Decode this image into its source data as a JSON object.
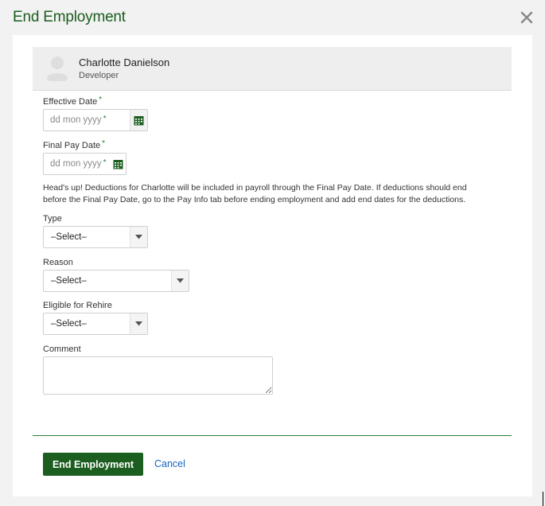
{
  "modal": {
    "title": "End Employment",
    "close_icon": "close-icon"
  },
  "employee": {
    "name": "Charlotte Danielson",
    "role": "Developer"
  },
  "fields": {
    "effective_date": {
      "label": "Effective Date",
      "required_mark": "*",
      "placeholder": "dd mon yyyy",
      "icon": "calendar-icon"
    },
    "final_pay_date": {
      "label": "Final Pay Date",
      "required_mark": "*",
      "placeholder": "dd mon yyyy",
      "icon": "calendar-icon"
    },
    "notice_line1": "Head's up! Deductions for Charlotte will be included in payroll through the Final Pay Date. If deductions should end",
    "notice_line2": "before the Final Pay Date, go to the Pay Info tab before ending employment and add end dates for the deductions.",
    "type": {
      "label": "Type",
      "value": "–Select–"
    },
    "reason": {
      "label": "Reason",
      "value": "–Select–"
    },
    "eligible_for_rehire": {
      "label": "Eligible for Rehire",
      "value": "–Select–"
    },
    "comment": {
      "label": "Comment",
      "value": ""
    }
  },
  "actions": {
    "submit_label": "End Employment",
    "cancel_label": "Cancel"
  },
  "colors": {
    "brand_green": "#1b5e20",
    "required_green": "#2e7d32",
    "link_blue": "#1565c0"
  }
}
